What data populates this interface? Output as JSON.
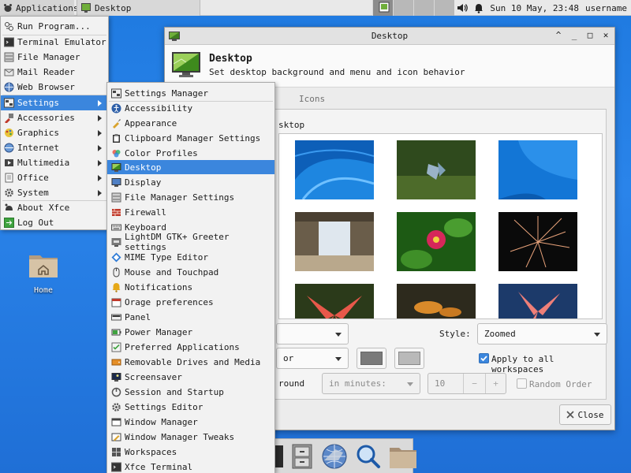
{
  "top_panel": {
    "applications_label": "Applications",
    "task_label": "Desktop",
    "clock": "Sun 10 May, 23:48",
    "username": "username"
  },
  "desktop": {
    "home_label": "Home"
  },
  "apps_menu": {
    "items": [
      {
        "label": "Run Program...",
        "icon": "run-icon"
      },
      {
        "label": "Terminal Emulator",
        "icon": "terminal-icon"
      },
      {
        "label": "File Manager",
        "icon": "file-manager-icon"
      },
      {
        "label": "Mail Reader",
        "icon": "mail-icon"
      },
      {
        "label": "Web Browser",
        "icon": "globe-icon"
      },
      {
        "label": "Settings",
        "icon": "settings-icon",
        "submenu": true,
        "selected": true
      },
      {
        "label": "Accessories",
        "icon": "accessories-icon",
        "submenu": true
      },
      {
        "label": "Graphics",
        "icon": "graphics-icon",
        "submenu": true
      },
      {
        "label": "Internet",
        "icon": "internet-icon",
        "submenu": true
      },
      {
        "label": "Multimedia",
        "icon": "multimedia-icon",
        "submenu": true
      },
      {
        "label": "Office",
        "icon": "office-icon",
        "submenu": true
      },
      {
        "label": "System",
        "icon": "system-icon",
        "submenu": true
      },
      {
        "label": "About Xfce",
        "icon": "about-icon"
      },
      {
        "label": "Log Out",
        "icon": "logout-icon"
      }
    ]
  },
  "settings_menu": {
    "items": [
      {
        "label": "Settings Manager"
      },
      {
        "label": "Accessibility"
      },
      {
        "label": "Appearance"
      },
      {
        "label": "Clipboard Manager Settings"
      },
      {
        "label": "Color Profiles"
      },
      {
        "label": "Desktop",
        "selected": true
      },
      {
        "label": "Display"
      },
      {
        "label": "File Manager Settings"
      },
      {
        "label": "Firewall"
      },
      {
        "label": "Keyboard"
      },
      {
        "label": "LightDM GTK+ Greeter settings"
      },
      {
        "label": "MIME Type Editor"
      },
      {
        "label": "Mouse and Touchpad"
      },
      {
        "label": "Notifications"
      },
      {
        "label": "Orage preferences"
      },
      {
        "label": "Panel"
      },
      {
        "label": "Power Manager"
      },
      {
        "label": "Preferred Applications"
      },
      {
        "label": "Removable Drives and Media"
      },
      {
        "label": "Screensaver"
      },
      {
        "label": "Session and Startup"
      },
      {
        "label": "Settings Editor"
      },
      {
        "label": "Window Manager"
      },
      {
        "label": "Window Manager Tweaks"
      },
      {
        "label": "Workspaces"
      },
      {
        "label": "Xfce Terminal"
      }
    ]
  },
  "desktop_window": {
    "title": "Desktop",
    "header_title": "Desktop",
    "header_subtitle": "Set desktop background and menu and icon behavior",
    "tab_partial": "s",
    "tab_icons": "Icons",
    "folder_label_partial": "sktop",
    "style_label": "Style:",
    "style_value": "Zoomed",
    "color_partial": "or",
    "apply_all_label": "Apply to all workspaces",
    "change_partial": "round",
    "interval_value": "in minutes:",
    "spin_value": "10",
    "spin_minus": "−",
    "spin_plus": "+",
    "random_label": "Random Order",
    "close_label": "Close",
    "apply_all_checked": true,
    "random_checked": false
  },
  "colors": {
    "accent": "#3b86dd",
    "desktop_bg": "#1f7ae0",
    "primary_swatch": "#7a7a7a",
    "secondary_swatch": "#b9b9b9"
  }
}
